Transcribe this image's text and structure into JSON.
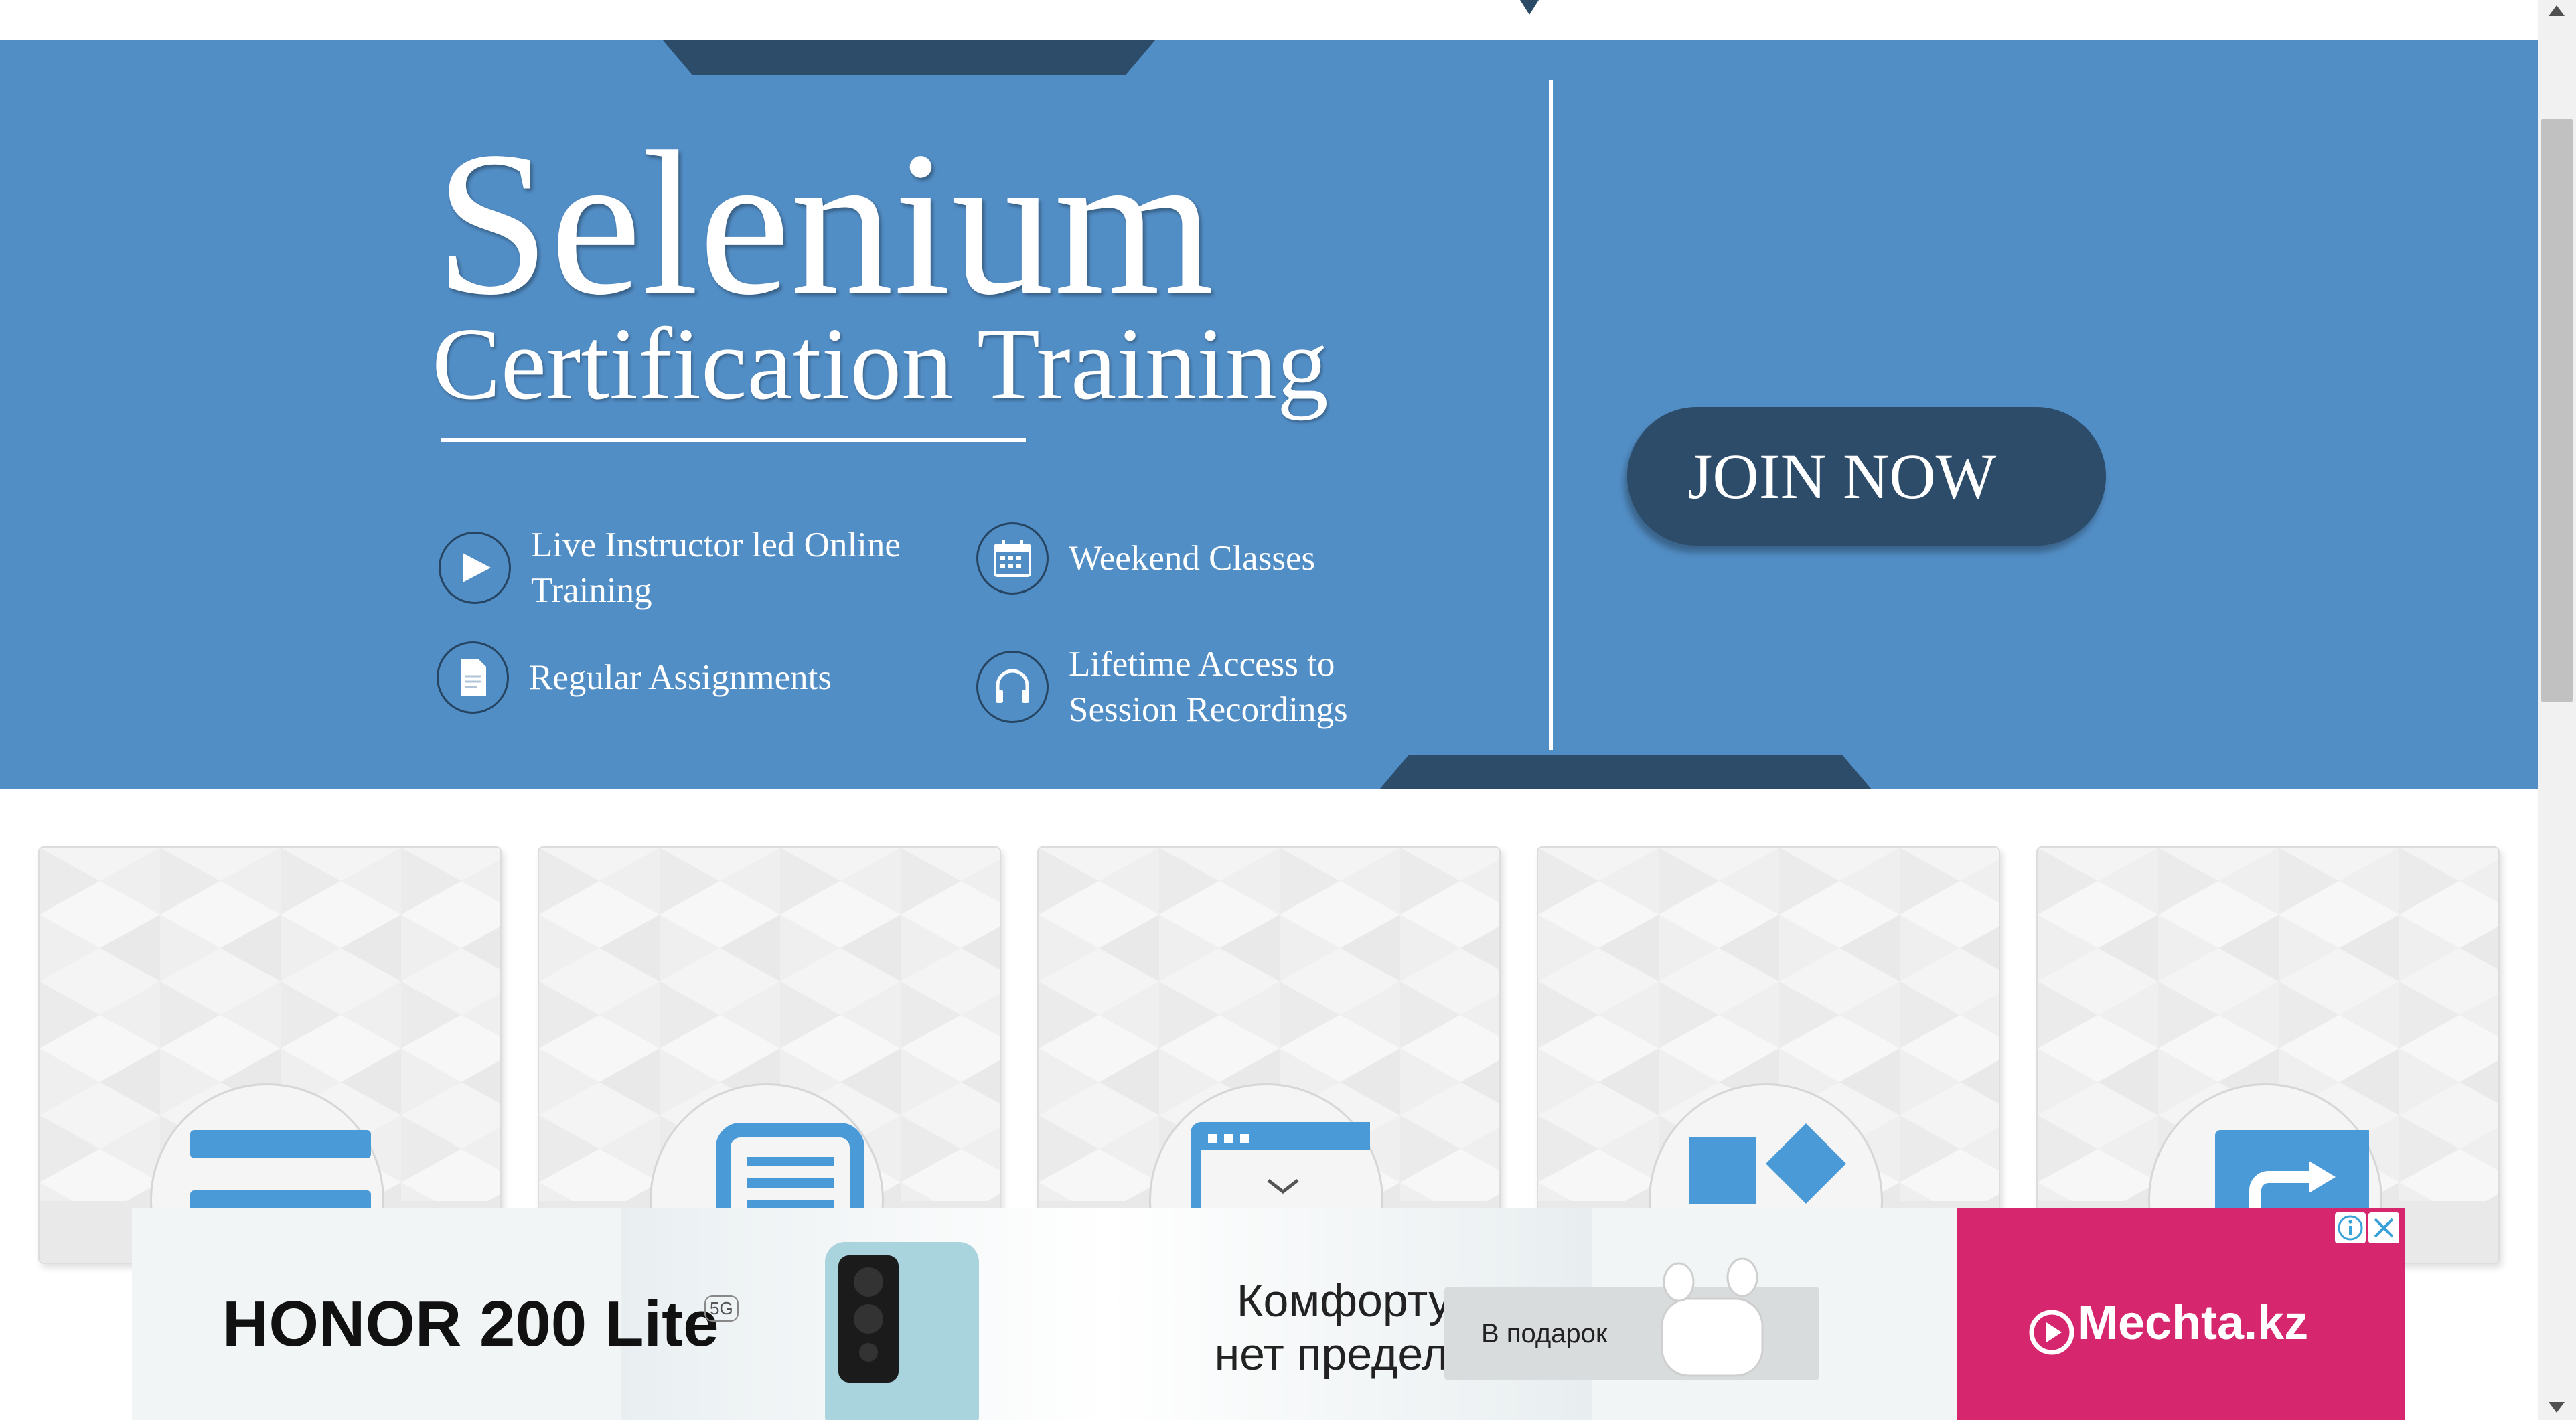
{
  "banner": {
    "title": "Selenium",
    "subtitle": "Certification Training",
    "features": [
      {
        "label": "Live Instructor led Online Training",
        "icon": "play-icon"
      },
      {
        "label": "Weekend Classes",
        "icon": "calendar-icon"
      },
      {
        "label": "Regular Assignments",
        "icon": "document-icon"
      },
      {
        "label": "Lifetime Access to Session Recordings",
        "icon": "headphones-icon"
      }
    ],
    "cta_label": "JOIN NOW",
    "colors": {
      "background": "#528ec6",
      "dark": "#2c4c6a",
      "text": "#ffffff"
    }
  },
  "cards": [
    {
      "icon": "menu-bars-icon"
    },
    {
      "icon": "document-lines-icon"
    },
    {
      "icon": "browser-window-icon"
    },
    {
      "icon": "shapes-icon"
    },
    {
      "icon": "share-arrow-icon"
    }
  ],
  "ad": {
    "brand": "HONOR 200 Lite",
    "badge": "5G",
    "tagline_line1": "Комфорту",
    "tagline_line2": "нет предела",
    "gift_label": "В подарок",
    "advertiser": "Mechta.kz",
    "colors": {
      "advertiser_bg": "#d6266e"
    }
  }
}
